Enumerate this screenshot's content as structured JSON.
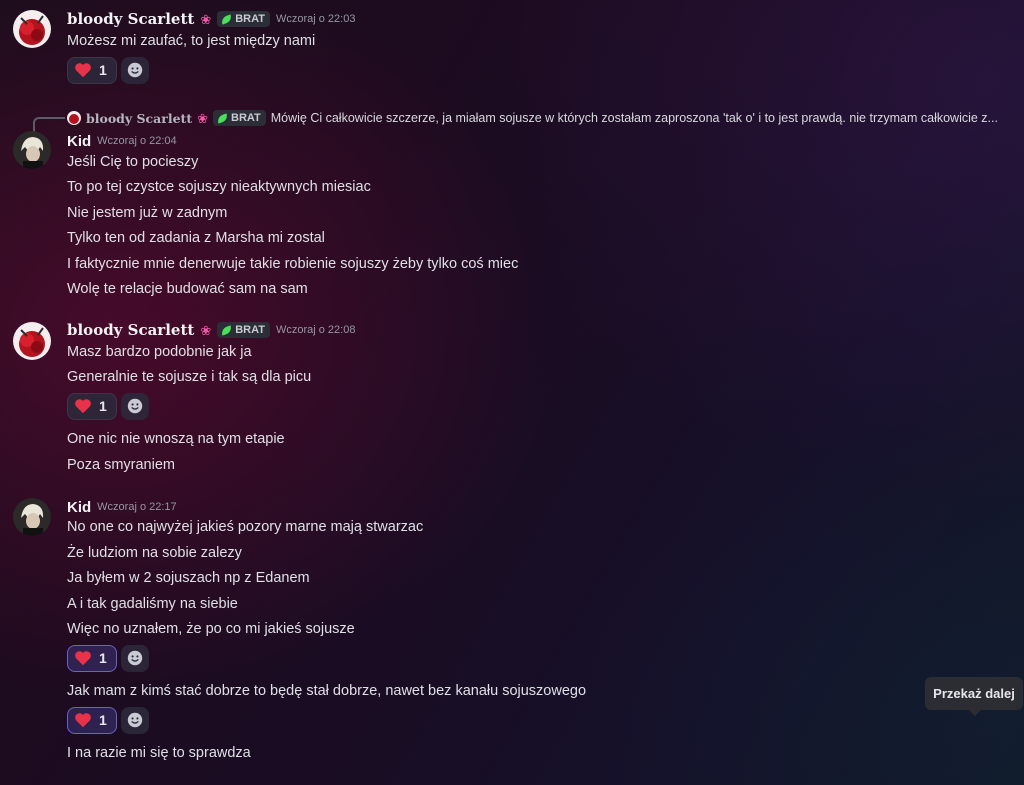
{
  "users": {
    "scarlett": {
      "name": "bloody Scarlett",
      "flower": "❀",
      "tag": "BRAT"
    },
    "kid": {
      "name": "Kid"
    }
  },
  "messages": [
    {
      "time": "Wczoraj o 22:03",
      "lines": [
        "Możesz mi zaufać, to jest między nami"
      ],
      "reaction_count": "1"
    },
    {
      "reply": {
        "name": "bloody Scarlett",
        "tag": "BRAT",
        "text": "Mówię Ci całkowicie szczerze, ja miałam sojusze w których zostałam zaproszona 'tak o' i to jest prawdą. nie trzymam całkowicie z..."
      },
      "time": "Wczoraj o 22:04",
      "lines": [
        "Jeśli Cię to pocieszy",
        "To po tej czystce sojuszy nieaktywnych miesiac",
        "Nie jestem już w zadnym",
        "Tylko ten od zadania z Marsha mi zostal",
        "I faktycznie mnie denerwuje takie robienie sojuszy żeby tylko coś miec",
        "Wolę te relacje budować sam na sam"
      ]
    },
    {
      "time": "Wczoraj o 22:08",
      "lines": [
        "Masz bardzo podobnie jak ja",
        "Generalnie te sojusze i tak są dla picu"
      ],
      "reaction_count": "1",
      "lines_after": [
        "One nic nie wnoszą na tym etapie",
        "Poza smyraniem"
      ]
    },
    {
      "time": "Wczoraj o 22:17",
      "lines": [
        "No one co najwyżej jakieś pozory marne mają stwarzac",
        "Że ludziom na sobie zalezy",
        "Ja byłem w 2 sojuszach np z Edanem",
        "A i tak gadaliśmy na siebie",
        "Więc no uznałem, że po co mi jakieś sojusze"
      ],
      "reaction_count": "1",
      "line_mid": "Jak mam z kimś stać dobrze to będę stał dobrze, nawet bez kanału sojuszowego",
      "reaction2_count": "1",
      "line_last": "I na razie mi się to sprawdza"
    }
  ],
  "tooltip": "Przekaż dalej",
  "colors": {
    "heart": "#e8324a",
    "accent": "#6a61d0",
    "tag_leaf": "#4ade5a"
  },
  "icons": {
    "heart": "heart-icon",
    "add_reaction": "add-reaction-icon",
    "leaf": "leaf-icon",
    "flower": "flower-icon"
  }
}
